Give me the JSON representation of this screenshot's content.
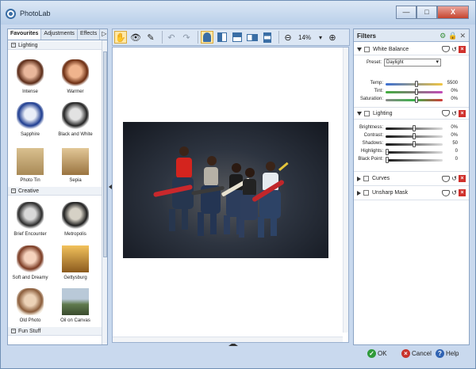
{
  "app": {
    "title": "PhotoLab",
    "colors": {
      "accent": "#3a6ea5",
      "bg": "#c9d9ee"
    }
  },
  "window_controls": {
    "minimize": "—",
    "maximize": "□",
    "close": "X"
  },
  "left_panel": {
    "tabs": [
      "Favourites",
      "Adjustments",
      "Effects"
    ],
    "tab_more": "▷",
    "sections": [
      {
        "name": "Lighting",
        "toggle": "−",
        "items": [
          "Intense",
          "Warmer",
          "Sapphire",
          "Black and White",
          "Photo Tin",
          "Sepia"
        ]
      },
      {
        "name": "Creative",
        "toggle": "−",
        "items": [
          "Brief Encounter",
          "Metropolis",
          "Soft and Dreamy",
          "Gettysburg",
          "Old Photo",
          "Oil on Canvas"
        ]
      },
      {
        "name": "Fun Stuff",
        "toggle": "−"
      }
    ]
  },
  "toolbar": {
    "icons": [
      "hand-icon",
      "eye-icon",
      "eraser-icon",
      "undo-icon",
      "redo-icon",
      "portrait-view-icon",
      "split-vertical-icon",
      "split-horizontal-icon",
      "compare-icon",
      "stack-icon",
      "zoom-out-icon",
      "zoom-in-icon"
    ],
    "zoom": "14%",
    "zoom_dropdown": "▾"
  },
  "filters": {
    "title": "Filters",
    "white_balance": {
      "name": "White Balance",
      "preset_label": "Preset:",
      "preset_value": "Daylight",
      "controls": [
        {
          "label": "Temp:",
          "value": "5500",
          "level": 0.54,
          "color": "linear-gradient(90deg,#3b6fd3,#f2c642)"
        },
        {
          "label": "Tint:",
          "value": "0%",
          "level": 0.54,
          "color": "linear-gradient(90deg,#3fae3c,#c44ab8)"
        },
        {
          "label": "Saturation:",
          "value": "0%",
          "level": 0.54,
          "color": "linear-gradient(90deg,#8a8a8a,#3bb34a,#d33a3a)"
        }
      ]
    },
    "lighting": {
      "name": "Lighting",
      "controls": [
        {
          "label": "Brightness:",
          "value": "0%",
          "level": 0.5
        },
        {
          "label": "Contrast:",
          "value": "0%",
          "level": 0.5
        },
        {
          "label": "Shadows:",
          "value": "50",
          "level": 0.5
        },
        {
          "label": "Highlights:",
          "value": "0",
          "level": 0.0
        },
        {
          "label": "Black Point:",
          "value": "0",
          "level": 0.0
        }
      ]
    },
    "curves": {
      "name": "Curves"
    },
    "unsharp_mask": {
      "name": "Unsharp Mask"
    }
  },
  "footer": {
    "ok": "OK",
    "cancel": "Cancel",
    "help": "Help"
  }
}
